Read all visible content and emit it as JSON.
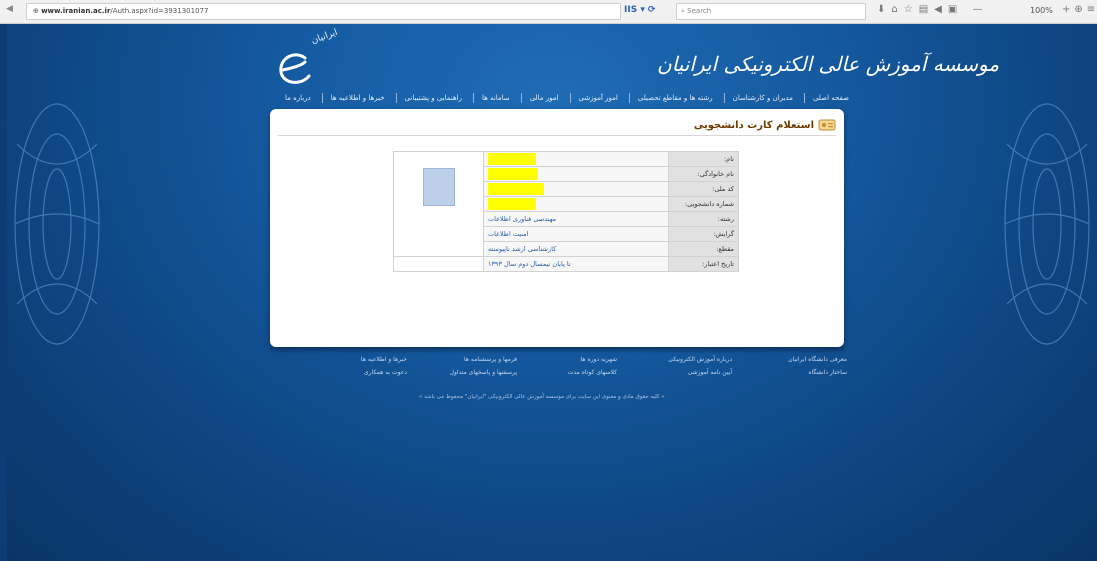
{
  "browser": {
    "url_host": "www.iranian.ac.ir",
    "url_path": "/Auth.aspx?id=3931301077",
    "search_placeholder": "Search",
    "zoom": "100%"
  },
  "header": {
    "site_title": "موسسه آموزش عالی الکترونیکی ایرانیان",
    "logo_small_text": "ایرانیان"
  },
  "nav": {
    "items": [
      "صفحه اصلی",
      "مدیران و کارشناسان",
      "رشته ها و مقاطع تحصیلی",
      "امور آموزشی",
      "امور مالی",
      "سامانه ها",
      "راهنمایی و پشتیبانی",
      "خبرها و اطلاعیه ها",
      "درباره ما"
    ]
  },
  "panel": {
    "title": "استعلام کارت دانشجویی",
    "rows": [
      {
        "label": "نام:",
        "value": ""
      },
      {
        "label": "نام خانوادگی:",
        "value": ""
      },
      {
        "label": "کد ملی:",
        "value": ""
      },
      {
        "label": "شماره دانشجویی:",
        "value": ""
      },
      {
        "label": "رشته:",
        "value": "مهندسی فناوری اطلاعات"
      },
      {
        "label": "گرایش:",
        "value": "امنیت اطلاعات"
      },
      {
        "label": "مقطع:",
        "value": "کارشناسی ارشد ناپیوسته"
      },
      {
        "label": "تاریخ اعتبار:",
        "value": "تا پایان نیمسال دوم سال ۱۳۹۳"
      }
    ]
  },
  "footer": {
    "col1": [
      "معرفی دانشگاه ایرانیان",
      "ساختار دانشگاه"
    ],
    "col2": [
      "درباره آموزش الکترونیکی",
      "آیین نامه آموزشی"
    ],
    "col3": [
      "شهریه دوره ها",
      "کلاسهای کوتاه مدت"
    ],
    "col4": [
      "فرمها و پرسشنامه ها",
      "پرسشها و پاسخهای متداول"
    ],
    "col5": [
      "خبرها و اطلاعیه ها",
      "دعوت به همکاری"
    ],
    "copyright": "« کلیه حقوق مادی و معنوی این سایت برای موسسه آموزش عالی الکترونیکی \"ایرانیان\" محفوظ می باشد »"
  },
  "colors": {
    "page_bg": "#155aa0",
    "highlight": "#ffff00",
    "link": "#2b5ea6"
  }
}
